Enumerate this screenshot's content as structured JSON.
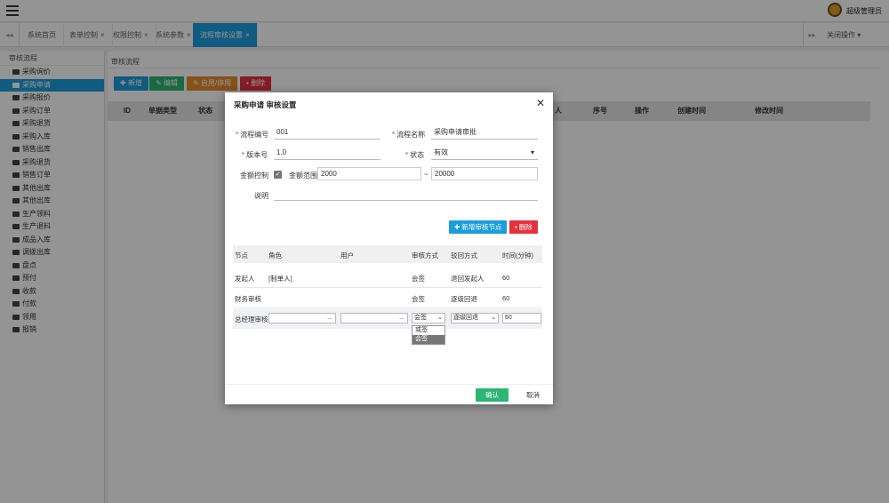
{
  "header": {
    "user_name": "超级管理员"
  },
  "tabs": [
    {
      "label": "系统首页"
    },
    {
      "label": "表单控制"
    },
    {
      "label": "权限控制"
    },
    {
      "label": "系统参数"
    },
    {
      "label": "流程审核设置"
    }
  ],
  "tabbar": {
    "close_ops": "关闭操作"
  },
  "sidebar": {
    "title": "审核流程",
    "items": [
      "采购询价",
      "采购申请",
      "采购报价",
      "采购订单",
      "采购退货",
      "采购入库",
      "销售出库",
      "采购退货",
      "销售订单",
      "其他出库",
      "其他出库",
      "生产领料",
      "生产退料",
      "成品入库",
      "调拨出库",
      "盘点",
      "预付",
      "收款",
      "付款",
      "领用",
      "报销"
    ]
  },
  "main": {
    "title": "审核流程",
    "buttons": {
      "add": "新增",
      "edit": "编辑",
      "toggle": "启用/停用",
      "delete": "删除"
    },
    "grid_headers": {
      "id": "ID",
      "doc_type": "单据类型",
      "status": "状态",
      "assignee": "人",
      "sort": "序号",
      "ops": "操作",
      "created": "创建时间",
      "modified": "修改时间"
    }
  },
  "modal": {
    "title": "采购申请 审核设置",
    "form": {
      "flow_no_label": "流程编号",
      "flow_no": "001",
      "flow_name_label": "流程名称",
      "flow_name": "采购申请审批",
      "version_label": "版本号",
      "version": "1.0",
      "status_label": "状态",
      "status": "有效",
      "amount_ctrl_label": "金额控制",
      "amount_range_label": "金额范围",
      "amount_min": "2000",
      "amount_max": "20000",
      "note_label": "说明",
      "note": ""
    },
    "buttons": {
      "add_node": "新增审核节点",
      "delete": "删除",
      "confirm": "确认",
      "cancel": "取消"
    },
    "table": {
      "headers": {
        "node": "节点",
        "role": "角色",
        "user": "用户",
        "mode": "审核方式",
        "reject": "驳回方式",
        "timeout": "时间(分钟)"
      },
      "rows": [
        {
          "node": "发起人",
          "role": "[制单人]",
          "user": "",
          "mode": "会签",
          "reject": "退回发起人",
          "timeout": "60"
        },
        {
          "node": "财务审核",
          "role": "",
          "user": "",
          "mode": "会签",
          "reject": "逐级回退",
          "timeout": "60"
        },
        {
          "node": "总经理审核",
          "role": "...",
          "user": "...",
          "mode": "会签",
          "reject": "逐级回退",
          "timeout": "60"
        }
      ]
    },
    "dropdown_options": [
      "或签",
      "会签"
    ]
  },
  "colors": {
    "primary": "#1c9ddc",
    "success": "#2bb673",
    "warning": "#e68a2e",
    "danger": "#e5323e"
  }
}
